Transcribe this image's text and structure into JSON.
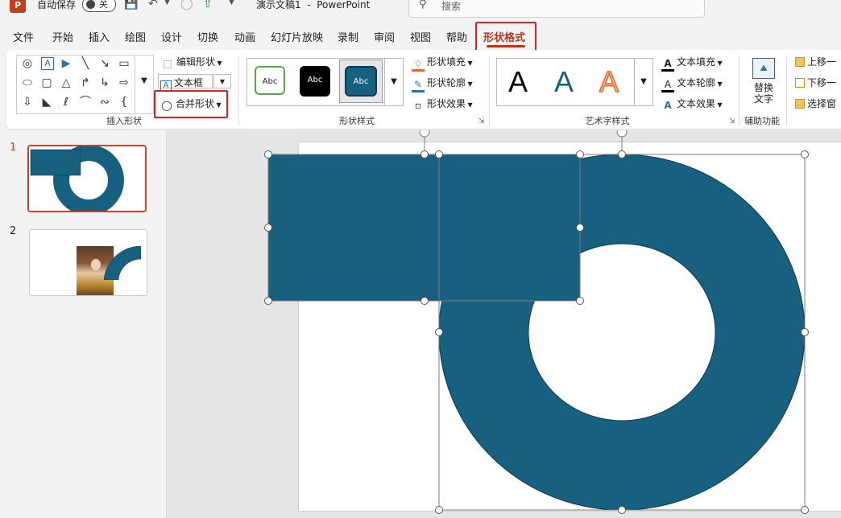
{
  "title_bar": {
    "app_badge": "P",
    "autosave_label": "自动保存",
    "autosave_state": "关",
    "doc_title": "演示文稿1  -  PowerPoint",
    "search_placeholder": "搜索"
  },
  "tabs": [
    "文件",
    "开始",
    "插入",
    "绘图",
    "设计",
    "切换",
    "动画",
    "幻灯片放映",
    "录制",
    "审阅",
    "视图",
    "帮助"
  ],
  "active_tab": "形状格式",
  "ribbon": {
    "insert_shapes": {
      "label": "插入形状",
      "edit_shape": "编辑形状",
      "text_box": "文本框",
      "merge_shapes": "合并形状"
    },
    "shape_styles": {
      "label": "形状样式",
      "tiles": [
        "Abc",
        "Abc",
        "Abc"
      ],
      "fill": "形状填充",
      "outline": "形状轮廓",
      "effects": "形状效果"
    },
    "wordart": {
      "label": "艺术字样式",
      "letters": [
        "A",
        "A",
        "A"
      ],
      "text_fill": "文本填充",
      "text_outline": "文本轮廓",
      "text_effects": "文本效果"
    },
    "accessibility": {
      "label": "辅助功能",
      "alt_text_line1": "替换",
      "alt_text_line2": "文字"
    },
    "arrange": {
      "bring_forward": "上移一",
      "send_backward": "下移一",
      "selection_pane": "选择窗"
    }
  },
  "slides": [
    {
      "number": "1"
    },
    {
      "number": "2"
    }
  ],
  "colors": {
    "accent": "#b5381c",
    "shape_fill": "#17607f",
    "highlight": "#e02020"
  },
  "icons": [
    "save-icon",
    "undo-icon",
    "redo-icon",
    "present-icon",
    "search-icon",
    "edit-shape-icon",
    "text-box-icon",
    "merge-shapes-icon",
    "shape-fill-icon",
    "shape-outline-icon",
    "shape-effects-icon",
    "alt-text-icon"
  ]
}
